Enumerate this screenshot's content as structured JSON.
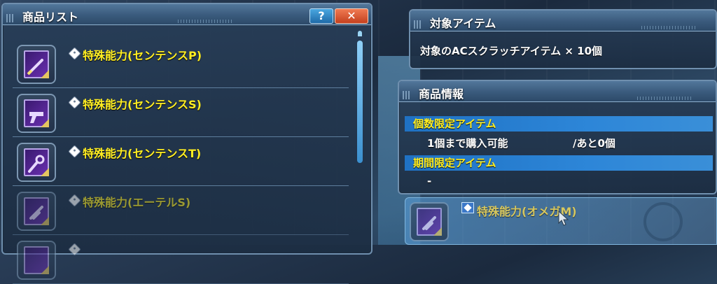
{
  "list_panel": {
    "title": "商品リスト",
    "help_label": "?",
    "close_label": "✕",
    "items": [
      {
        "name": "特殊能力(センテンスP)",
        "icon": "sword-icon",
        "state": "normal"
      },
      {
        "name": "特殊能力(センテンスS)",
        "icon": "gun-icon",
        "state": "normal"
      },
      {
        "name": "特殊能力(センテンスT)",
        "icon": "wand-icon",
        "state": "normal"
      },
      {
        "name": "特殊能力(エーテルS)",
        "icon": "gun-icon",
        "state": "disabled"
      }
    ]
  },
  "target_panel": {
    "title": "対象アイテム",
    "text": "対象のACスクラッチアイテム × 10個"
  },
  "info_panel": {
    "title": "商品情報",
    "limited_count_head": "個数限定アイテム",
    "limited_count_value": "1個まで購入可能",
    "limited_count_remaining": "/あと0個",
    "limited_period_head": "期間限定アイテム",
    "limited_period_value": "-"
  },
  "selected_item": {
    "name": "特殊能力(オメガM)",
    "icon": "gun-icon"
  },
  "colors": {
    "item_name": "#ffee22",
    "close_button": "#d4532a",
    "help_button": "#2a86c8"
  }
}
